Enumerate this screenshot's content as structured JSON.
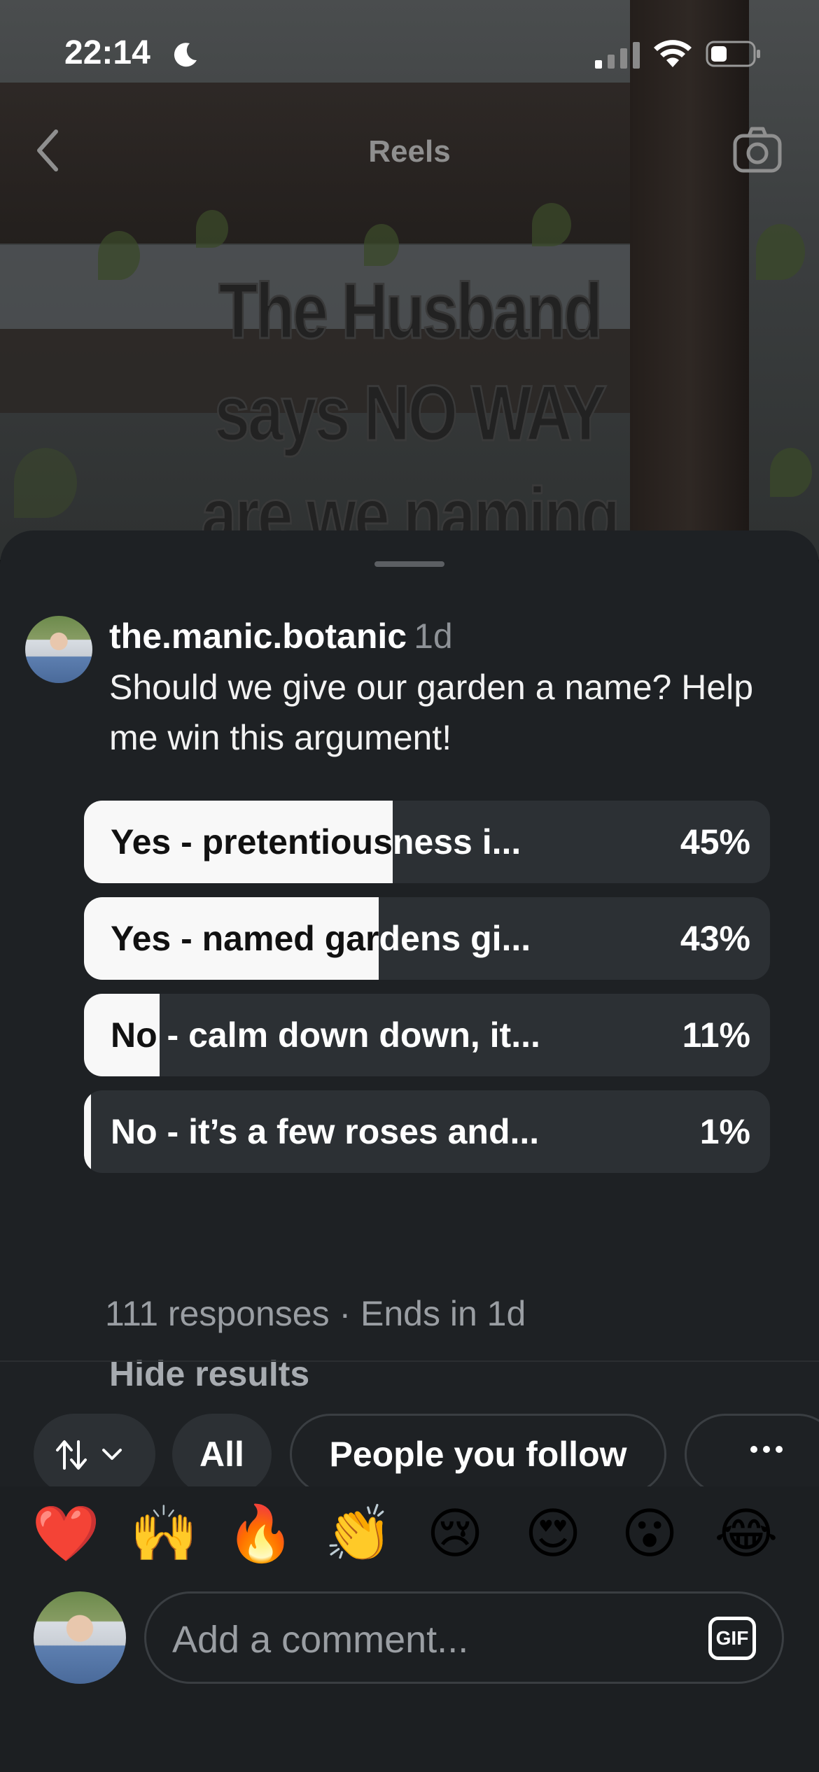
{
  "status_bar": {
    "time": "22:14",
    "icons": [
      "moon-icon",
      "cellular-signal-icon",
      "wifi-icon",
      "battery-icon"
    ]
  },
  "nav": {
    "title": "Reels",
    "back_icon": "chevron-left-icon",
    "camera_icon": "camera-icon"
  },
  "video": {
    "overlay_lines": [
      "The Husband",
      "says NO WAY",
      "are we naming"
    ]
  },
  "post": {
    "username": "the.manic.botanic",
    "age": "1d",
    "caption": "Should we give our garden a name? Help me win this argument!"
  },
  "poll": {
    "options": [
      {
        "label": "Yes - pretentiousness i...",
        "percent_text": "45%",
        "fill": 0.45
      },
      {
        "label": "Yes - named gardens gi...",
        "percent_text": "43%",
        "fill": 0.43
      },
      {
        "label": "No - calm down down, it...",
        "percent_text": "11%",
        "fill": 0.11
      },
      {
        "label": "No - it’s a few roses and...",
        "percent_text": "1%",
        "fill": 0.01
      }
    ],
    "responses": "111 responses · Ends in 1d",
    "hide_results": "Hide results"
  },
  "filters": {
    "sort_icon": "sort-arrows-icon",
    "all": "All",
    "people_you_follow": "People you follow",
    "more_icon": "more-horizontal-icon"
  },
  "quick_reactions": [
    "❤️",
    "🙌",
    "🔥",
    "👏",
    "😢",
    "😍",
    "😮",
    "😂"
  ],
  "comment": {
    "placeholder": "Add a comment...",
    "gif_label": "GIF"
  },
  "colors": {
    "sheet_bg": "#1e2124",
    "poll_track": "#2c3034",
    "poll_fill": "#f8f8f8",
    "muted_text": "#9a9ea3"
  }
}
